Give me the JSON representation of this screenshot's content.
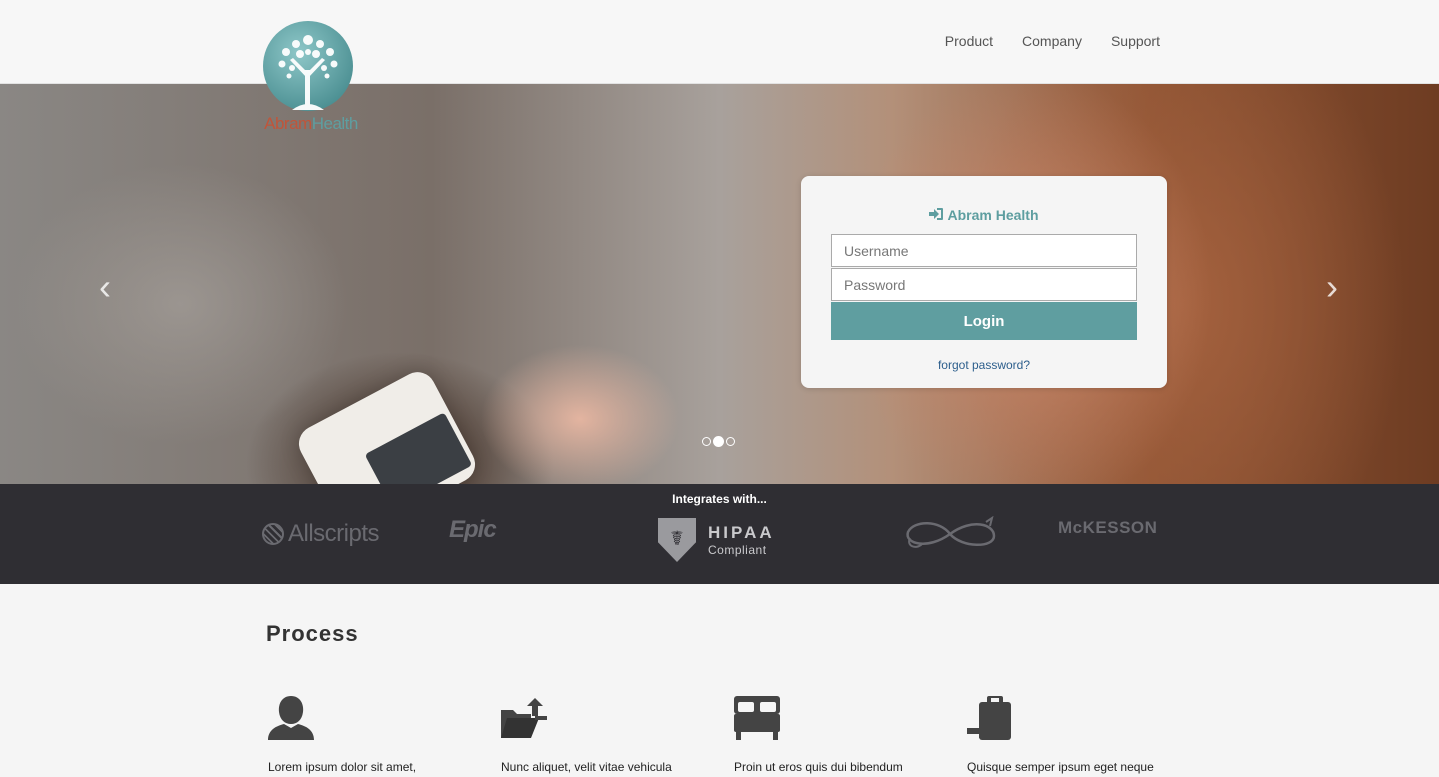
{
  "header": {
    "logo": {
      "word1": "Abram",
      "word2": "Health"
    },
    "nav": [
      "Product",
      "Company",
      "Support"
    ]
  },
  "hero": {
    "prev_arrow": "‹",
    "next_arrow": "›",
    "slides_count": 3,
    "active_slide": 2
  },
  "login": {
    "title": "Abram Health",
    "username_placeholder": "Username",
    "password_placeholder": "Password",
    "login_label": "Login",
    "forgot_label": "forgot password?"
  },
  "integrations": {
    "title": "Integrates with...",
    "partners": {
      "allscripts": "Allscripts",
      "epic": "Epic",
      "hipaa_big": "HIPAA",
      "hipaa_small": "Compliant",
      "mckesson": "McKESSON"
    }
  },
  "process": {
    "title": "Process",
    "steps": [
      {
        "icon": "user-icon",
        "text": "Lorem ipsum dolor sit amet,"
      },
      {
        "icon": "folder-transfer-icon",
        "text": "Nunc aliquet, velit vitae vehicula"
      },
      {
        "icon": "bed-icon",
        "text": "Proin ut eros quis dui bibendum"
      },
      {
        "icon": "clipboard-enter-icon",
        "text": "Quisque semper ipsum eget neque"
      }
    ]
  },
  "colors": {
    "accent": "#5f9ea0",
    "integrations_bg": "#2f2e33",
    "page_bg": "#f5f5f5"
  }
}
